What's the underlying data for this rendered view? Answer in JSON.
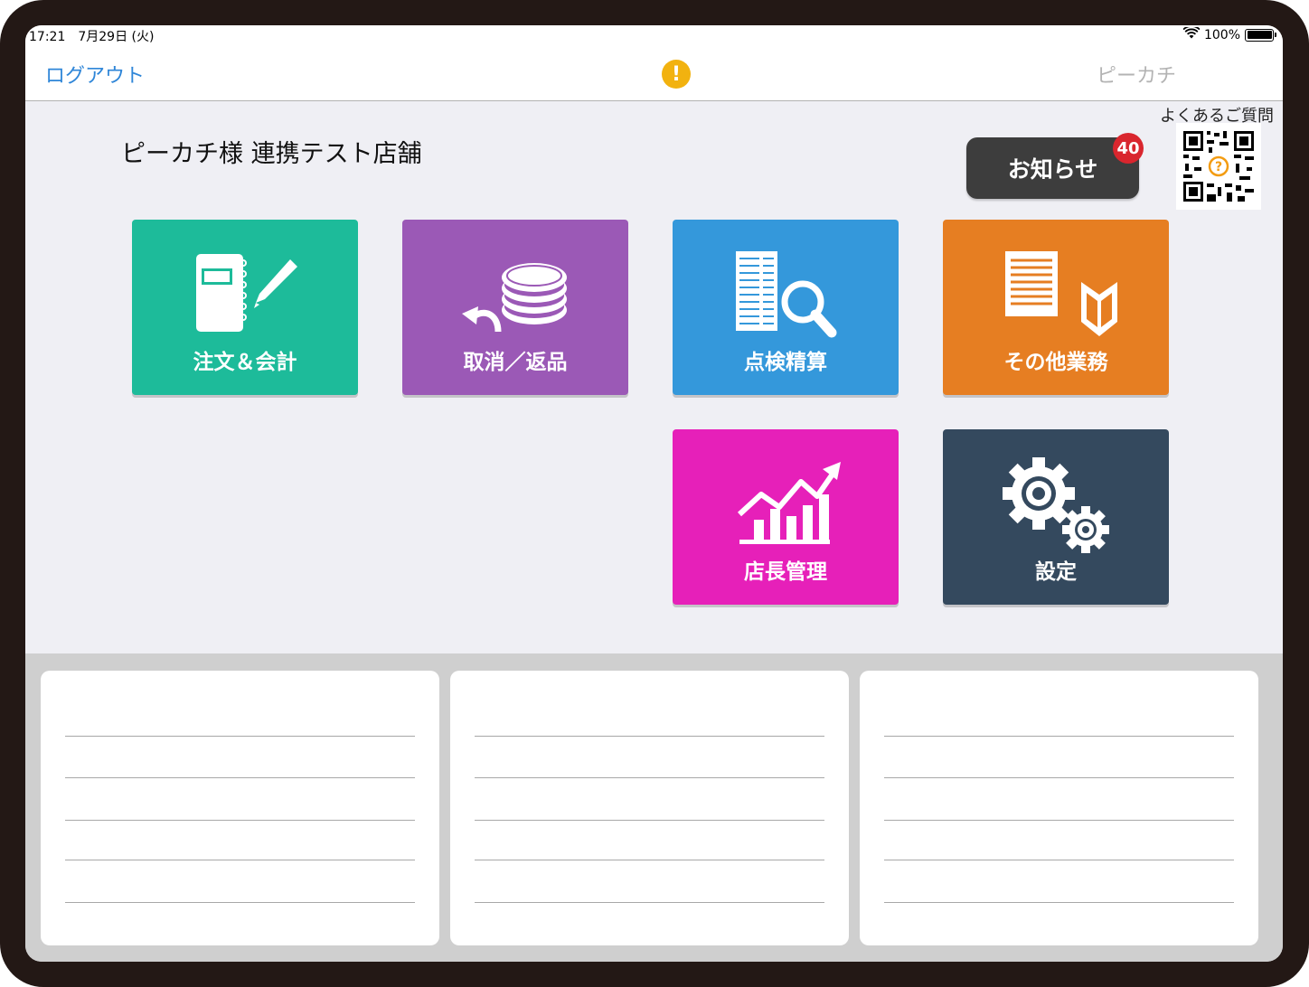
{
  "status_bar": {
    "time": "17:21　7月29日 (火)",
    "battery": "100%"
  },
  "nav": {
    "logout": "ログアウト",
    "app_title": "ピーカチ"
  },
  "faq": {
    "label": "よくあるご質問"
  },
  "store_name": "ピーカチ様 連携テスト店舗",
  "notice": {
    "label": "お知らせ",
    "count": "40"
  },
  "tiles": [
    {
      "label": "注文＆会計",
      "color": "#1dbb9a"
    },
    {
      "label": "取消／返品",
      "color": "#9b59b6"
    },
    {
      "label": "点検精算",
      "color": "#3498db"
    },
    {
      "label": "その他業務",
      "color": "#e67e22"
    },
    {
      "label": "店長管理",
      "color": "#e620b9"
    },
    {
      "label": "設定",
      "color": "#34495e"
    }
  ]
}
